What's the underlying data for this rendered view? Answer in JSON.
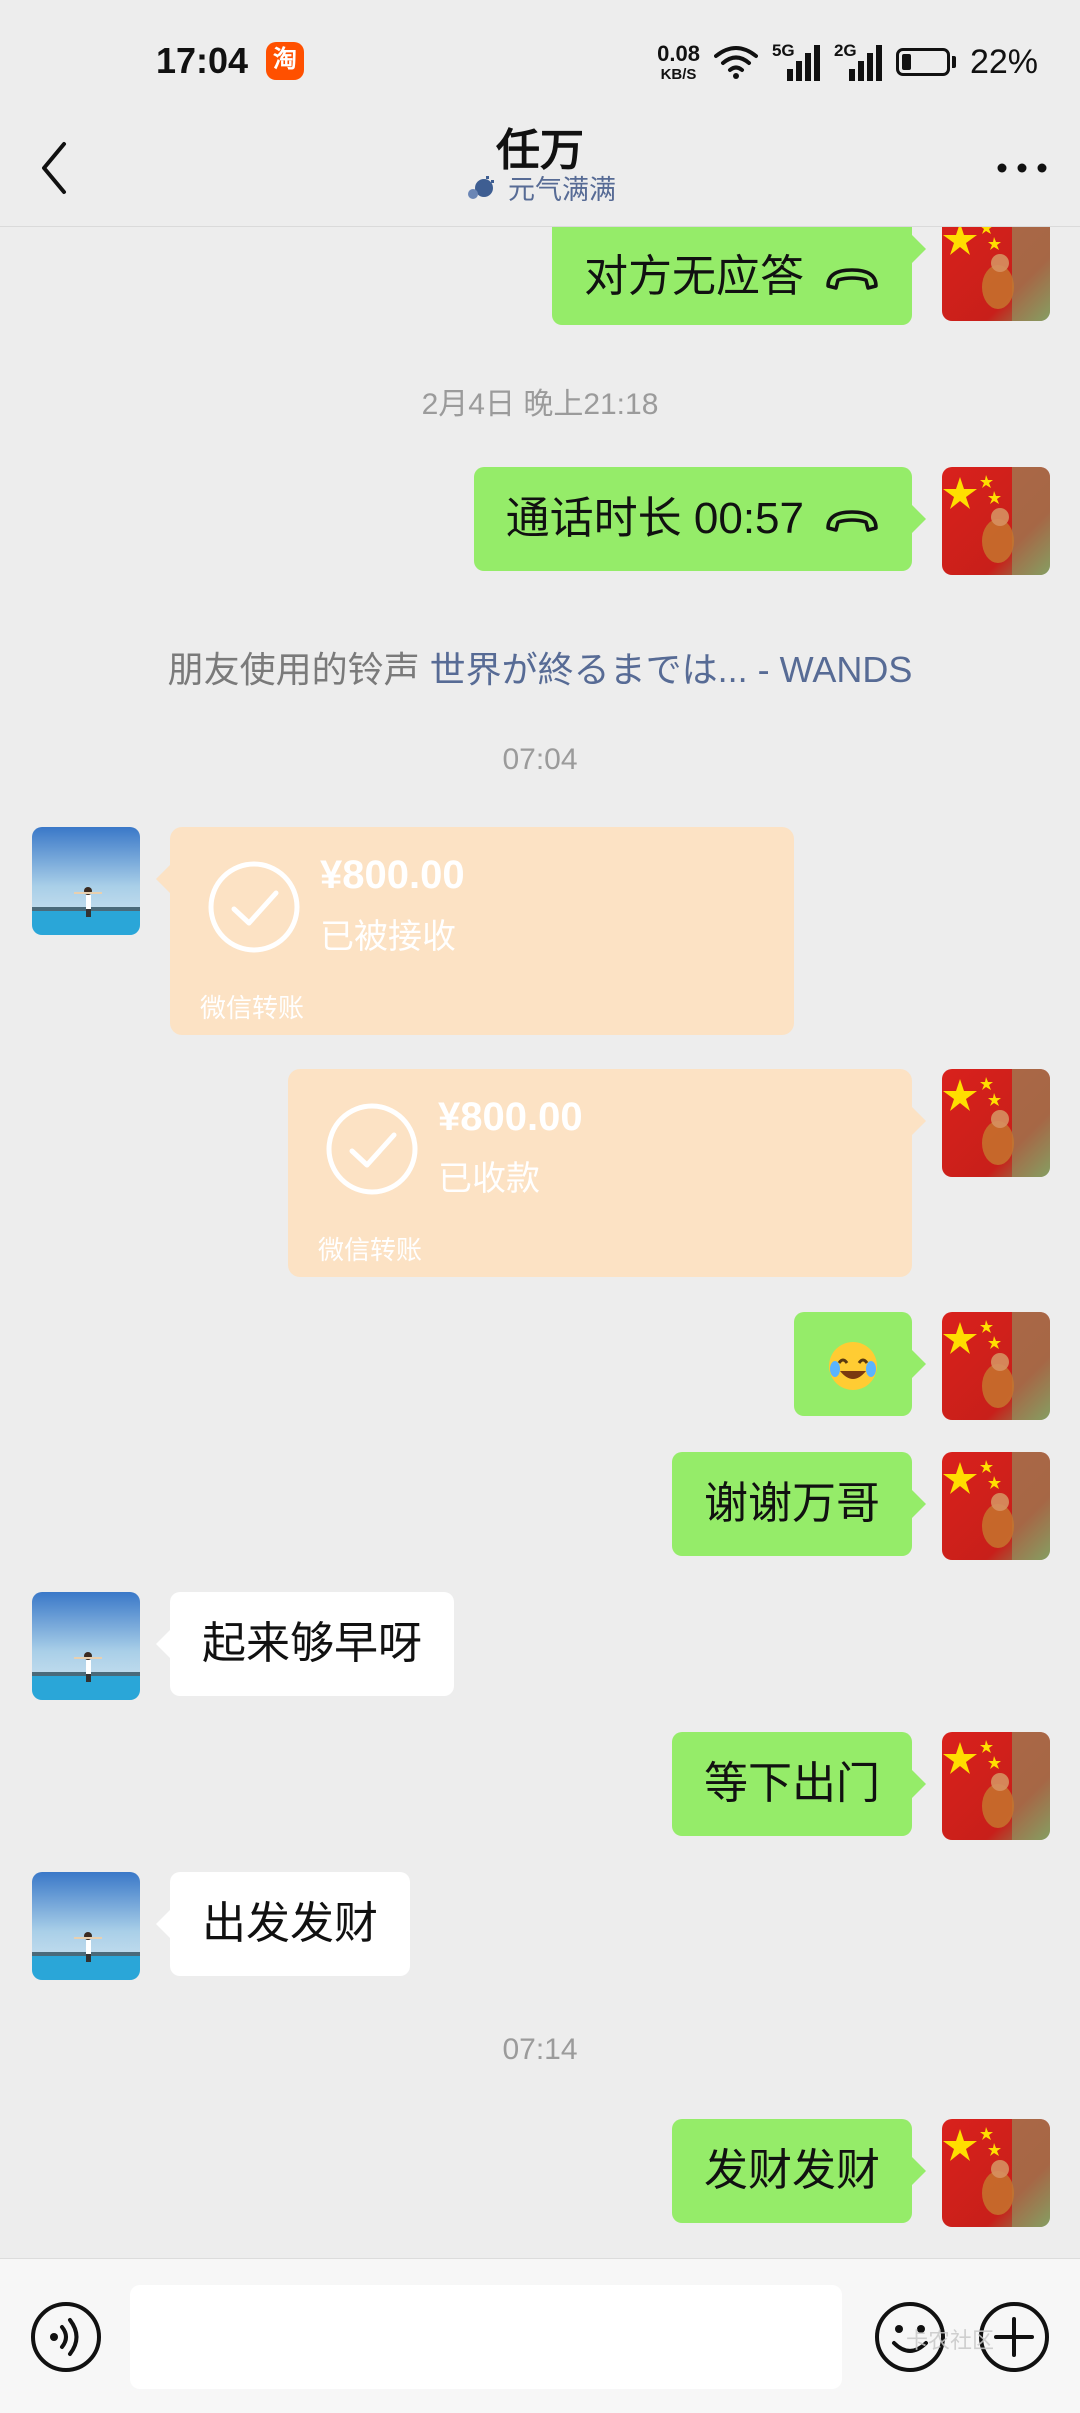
{
  "status_bar": {
    "time": "17:04",
    "app_icon_text": "淘",
    "net_speed": "0.08",
    "net_speed_unit": "KB/S",
    "sim1_label": "5G",
    "sim2_label": "2G",
    "battery_level": 0.22,
    "battery_percent": "22%",
    "icons": [
      "taobao-icon",
      "wifi-icon",
      "signal-5g-icon",
      "signal-2g-icon",
      "battery-icon"
    ]
  },
  "header": {
    "title": "任万",
    "status_text": "元气满满",
    "icons": [
      "back-icon",
      "status-emoji-icon",
      "more-icon"
    ]
  },
  "messages": {
    "m1": {
      "text": "对方无应答",
      "sender": "me",
      "icon": "call-hangup-icon"
    },
    "t1": "2月4日 晚上21:18",
    "m2": {
      "text": "通话时长 00:57",
      "sender": "me",
      "icon": "call-hangup-icon"
    },
    "ringtone": {
      "prefix": "朋友使用的铃声",
      "song": "世界が終るまでは... - WANDS"
    },
    "t2": "07:04",
    "transfer1": {
      "sender": "other",
      "amount": "¥800.00",
      "status": "已被接收",
      "footer": "微信转账"
    },
    "transfer2": {
      "sender": "me",
      "amount": "¥800.00",
      "status": "已收款",
      "footer": "微信转账"
    },
    "m3": {
      "sender": "me",
      "icon": "crying-laughing-emoji-icon"
    },
    "m4": {
      "text": "谢谢万哥",
      "sender": "me"
    },
    "m5": {
      "text": "起来够早呀",
      "sender": "other"
    },
    "m6": {
      "text": "等下出门",
      "sender": "me"
    },
    "m7": {
      "text": "出发发财",
      "sender": "other"
    },
    "t3": "07:14",
    "m8": {
      "text": "发财发财",
      "sender": "me"
    }
  },
  "input_bar": {
    "value": "",
    "watermark": "卡农社区",
    "icons": [
      "voice-icon",
      "emoji-icon",
      "plus-icon"
    ]
  },
  "colors": {
    "background": "#ededed",
    "my_bubble": "#95ec69",
    "their_bubble": "#ffffff",
    "transfer_card": "#fce2c4",
    "link": "#576b95",
    "timestamp": "#9b9b9b"
  }
}
